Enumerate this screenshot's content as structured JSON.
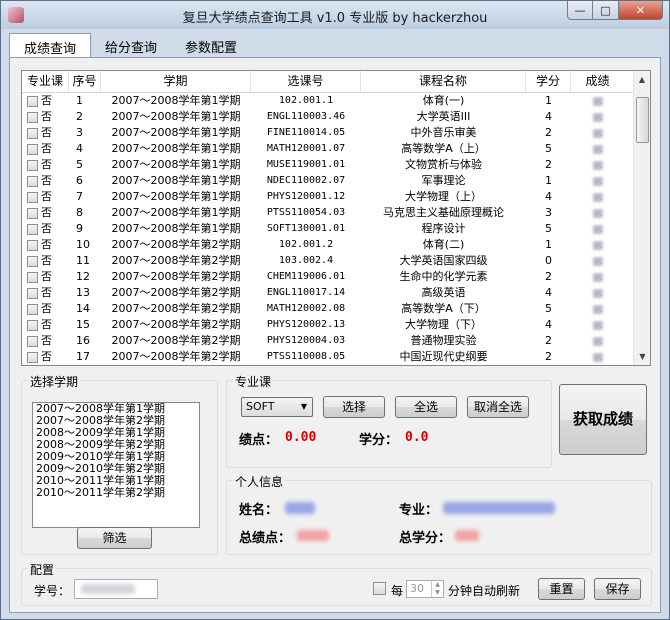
{
  "window": {
    "title": "复旦大学绩点查询工具 v1.0 专业版 by hackerzhou",
    "min_glyph": "—",
    "max_glyph": "□",
    "close_glyph": "✕"
  },
  "tabs": [
    {
      "label": "成绩查询",
      "active": true
    },
    {
      "label": "给分查询",
      "active": false
    },
    {
      "label": "参数配置",
      "active": false
    }
  ],
  "grid": {
    "headers": [
      "专业课",
      "序号",
      "学期",
      "选课号",
      "课程名称",
      "学分",
      "成绩"
    ],
    "rows": [
      {
        "major": "否",
        "no": "1",
        "term": "2007～2008学年第1学期",
        "code": "102.001.1",
        "name": "体育(一)",
        "credit": "1"
      },
      {
        "major": "否",
        "no": "2",
        "term": "2007～2008学年第1学期",
        "code": "ENGL110003.46",
        "name": "大学英语III",
        "credit": "4"
      },
      {
        "major": "否",
        "no": "3",
        "term": "2007～2008学年第1学期",
        "code": "FINE110014.05",
        "name": "中外音乐审美",
        "credit": "2"
      },
      {
        "major": "否",
        "no": "4",
        "term": "2007～2008学年第1学期",
        "code": "MATH120001.07",
        "name": "高等数学A（上）",
        "credit": "5"
      },
      {
        "major": "否",
        "no": "5",
        "term": "2007～2008学年第1学期",
        "code": "MUSE119001.01",
        "name": "文物赏析与体验",
        "credit": "2"
      },
      {
        "major": "否",
        "no": "6",
        "term": "2007～2008学年第1学期",
        "code": "NDEC110002.07",
        "name": "军事理论",
        "credit": "1"
      },
      {
        "major": "否",
        "no": "7",
        "term": "2007～2008学年第1学期",
        "code": "PHYS120001.12",
        "name": "大学物理（上）",
        "credit": "4"
      },
      {
        "major": "否",
        "no": "8",
        "term": "2007～2008学年第1学期",
        "code": "PTSS110054.03",
        "name": "马克思主义基础原理概论",
        "credit": "3"
      },
      {
        "major": "否",
        "no": "9",
        "term": "2007～2008学年第1学期",
        "code": "SOFT130001.01",
        "name": "程序设计",
        "credit": "5"
      },
      {
        "major": "否",
        "no": "10",
        "term": "2007～2008学年第2学期",
        "code": "102.001.2",
        "name": "体育(二)",
        "credit": "1"
      },
      {
        "major": "否",
        "no": "11",
        "term": "2007～2008学年第2学期",
        "code": "103.002.4",
        "name": "大学英语国家四级",
        "credit": "0"
      },
      {
        "major": "否",
        "no": "12",
        "term": "2007～2008学年第2学期",
        "code": "CHEM119006.01",
        "name": "生命中的化学元素",
        "credit": "2"
      },
      {
        "major": "否",
        "no": "13",
        "term": "2007～2008学年第2学期",
        "code": "ENGL110017.14",
        "name": "高级英语",
        "credit": "4"
      },
      {
        "major": "否",
        "no": "14",
        "term": "2007～2008学年第2学期",
        "code": "MATH120002.08",
        "name": "高等数学A（下）",
        "credit": "5"
      },
      {
        "major": "否",
        "no": "15",
        "term": "2007～2008学年第2学期",
        "code": "PHYS120002.13",
        "name": "大学物理（下）",
        "credit": "4"
      },
      {
        "major": "否",
        "no": "16",
        "term": "2007～2008学年第2学期",
        "code": "PHYS120004.03",
        "name": "普通物理实验",
        "credit": "2"
      },
      {
        "major": "否",
        "no": "17",
        "term": "2007～2008学年第2学期",
        "code": "PTSS110008.05",
        "name": "中国近现代史纲要",
        "credit": "2"
      }
    ]
  },
  "term_select": {
    "title": "选择学期",
    "items": [
      "2007～2008学年第1学期",
      "2007～2008学年第2学期",
      "2008～2009学年第1学期",
      "2008～2009学年第2学期",
      "2009～2010学年第1学期",
      "2009～2010学年第2学期",
      "2010～2011学年第1学期",
      "2010～2011学年第2学期"
    ],
    "filter_button": "筛选"
  },
  "major": {
    "title": "专业课",
    "selected": "SOFT",
    "select_button": "选择",
    "select_all_button": "全选",
    "deselect_all_button": "取消全选",
    "gpa_label": "绩点：",
    "gpa_value": "0.00",
    "credit_label": "学分：",
    "credit_value": "0.0"
  },
  "fetch_button": "获取成绩",
  "personal": {
    "title": "个人信息",
    "name_label": "姓名：",
    "major_label": "专业：",
    "total_gpa_label": "总绩点：",
    "total_credit_label": "总学分："
  },
  "config": {
    "title": "配置",
    "student_id_label": "学号：",
    "every_label": "每",
    "interval_value": "30",
    "auto_refresh_label": "分钟自动刷新",
    "reset_button": "重置",
    "save_button": "保存"
  },
  "colors": {
    "accent_red": "#e00000",
    "window_frame": "#cfdbe8"
  }
}
